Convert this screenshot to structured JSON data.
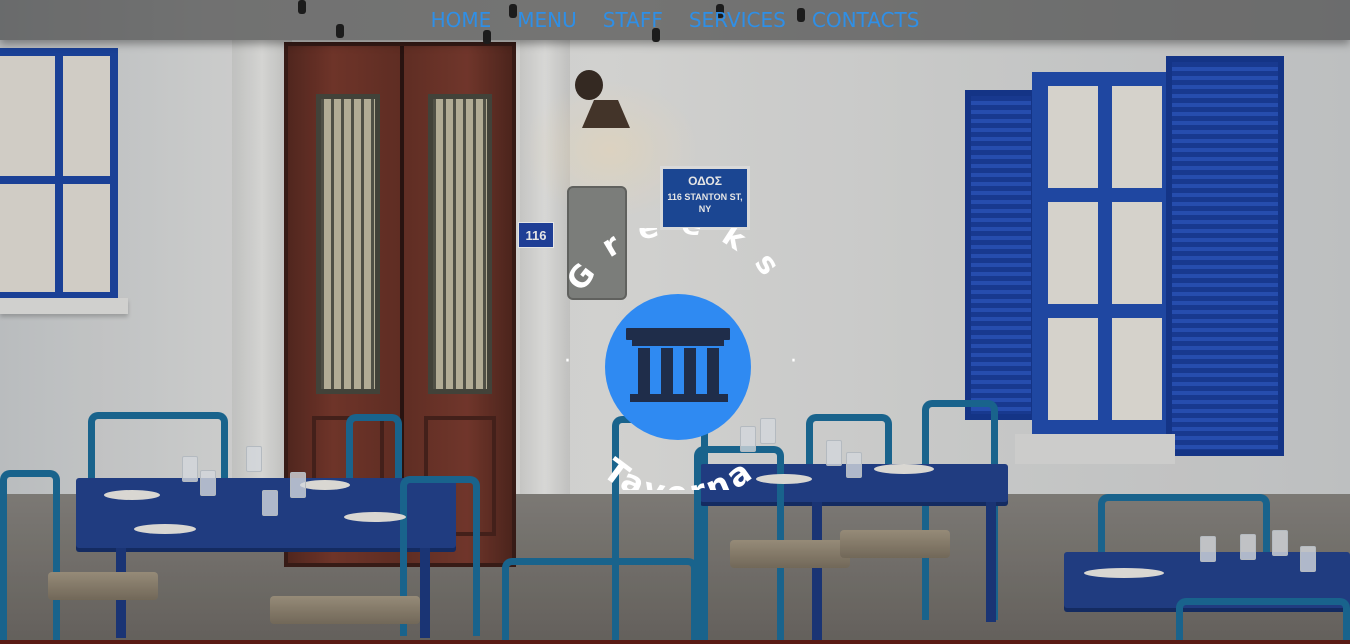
{
  "nav": {
    "items": [
      {
        "label": "HOME"
      },
      {
        "label": "MENU"
      },
      {
        "label": "STAFF"
      },
      {
        "label": "SERVICES"
      },
      {
        "label": "CONTACTS"
      }
    ],
    "link_color": "#2f8fe6"
  },
  "logo": {
    "top_text": "Greeks",
    "bottom_text": "Taverna",
    "separator": "·",
    "icon": "greek-temple-icon",
    "circle_color": "#2f8af2"
  },
  "scene": {
    "door_number": "116",
    "street_sign_title": "ΟΔΟΣ",
    "street_sign_line1": "116 STANTON ST,",
    "street_sign_line2": "NY"
  }
}
